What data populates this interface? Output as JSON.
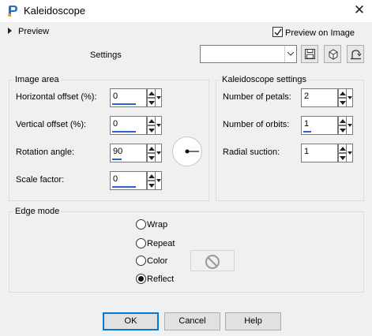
{
  "window": {
    "title": "Kaleidoscope",
    "close_glyph": "✕",
    "app_icon": "paintshop-icon"
  },
  "preview": {
    "toggle_label": "Preview",
    "preview_on_image_label": "Preview on Image",
    "preview_on_image_checked": true
  },
  "settings": {
    "label": "Settings",
    "combo_value": "",
    "tools": [
      "save-preset-icon",
      "reset-icon",
      "randomize-icon"
    ]
  },
  "image_area": {
    "title": "Image area",
    "horizontal_offset_label": "Horizontal offset (%):",
    "horizontal_offset_value": "0",
    "vertical_offset_label": "Vertical offset (%):",
    "vertical_offset_value": "0",
    "rotation_label": "Rotation angle:",
    "rotation_value": "90",
    "scale_label": "Scale factor:",
    "scale_value": "0"
  },
  "kaleido": {
    "title": "Kaleidoscope settings",
    "petals_label": "Number of petals:",
    "petals_value": "2",
    "orbits_label": "Number of orbits:",
    "orbits_value": "1",
    "suction_label": "Radial suction:",
    "suction_value": "1"
  },
  "edge_mode": {
    "title": "Edge mode",
    "options": [
      "Wrap",
      "Repeat",
      "Color",
      "Reflect"
    ],
    "selected": "Reflect"
  },
  "buttons": {
    "ok": "OK",
    "cancel": "Cancel",
    "help": "Help"
  },
  "colors": {
    "accent": "#2a63c9",
    "dialog_bg": "#f0f0f0",
    "default_button_border": "#0078d7"
  }
}
